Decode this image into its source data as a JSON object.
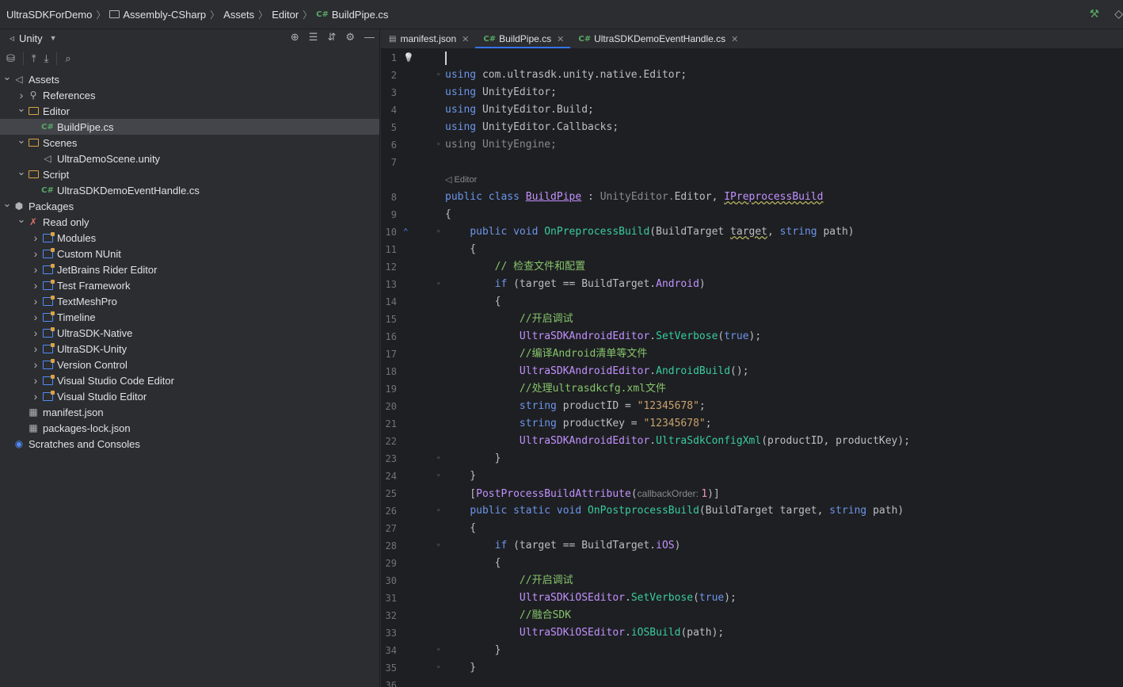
{
  "breadcrumb": {
    "items": [
      "UltraSDKForDemo",
      "Assembly-CSharp",
      "Assets",
      "Editor",
      "BuildPipe.cs"
    ],
    "cs_badge": "C#"
  },
  "panel": {
    "title": "Unity",
    "tree": [
      {
        "label": "Assets",
        "depth": 0,
        "expanded": true,
        "icon": "unity-asset-icon"
      },
      {
        "label": "References",
        "depth": 1,
        "expanded": false,
        "icon": "references-icon"
      },
      {
        "label": "Editor",
        "depth": 1,
        "expanded": true,
        "icon": "folder-icon"
      },
      {
        "label": "BuildPipe.cs",
        "depth": 2,
        "icon": "csharp-file-icon",
        "selected": true
      },
      {
        "label": "Scenes",
        "depth": 1,
        "expanded": true,
        "icon": "folder-icon"
      },
      {
        "label": "UltraDemoScene.unity",
        "depth": 2,
        "icon": "unity-scene-icon"
      },
      {
        "label": "Script",
        "depth": 1,
        "expanded": true,
        "icon": "folder-icon"
      },
      {
        "label": "UltraSDKDemoEventHandle.cs",
        "depth": 2,
        "icon": "csharp-file-icon"
      },
      {
        "label": "Packages",
        "depth": 0,
        "expanded": true,
        "icon": "packages-icon"
      },
      {
        "label": "Read only",
        "depth": 1,
        "expanded": true,
        "icon": "read-only-icon"
      },
      {
        "label": "Modules",
        "depth": 2,
        "expanded": false,
        "icon": "package-icon"
      },
      {
        "label": "Custom NUnit",
        "depth": 2,
        "expanded": false,
        "icon": "package-icon"
      },
      {
        "label": "JetBrains Rider Editor",
        "depth": 2,
        "expanded": false,
        "icon": "package-icon"
      },
      {
        "label": "Test Framework",
        "depth": 2,
        "expanded": false,
        "icon": "package-icon"
      },
      {
        "label": "TextMeshPro",
        "depth": 2,
        "expanded": false,
        "icon": "package-icon"
      },
      {
        "label": "Timeline",
        "depth": 2,
        "expanded": false,
        "icon": "package-icon"
      },
      {
        "label": "UltraSDK-Native",
        "depth": 2,
        "expanded": false,
        "icon": "package-icon"
      },
      {
        "label": "UltraSDK-Unity",
        "depth": 2,
        "expanded": false,
        "icon": "package-icon"
      },
      {
        "label": "Version Control",
        "depth": 2,
        "expanded": false,
        "icon": "package-icon"
      },
      {
        "label": "Visual Studio Code Editor",
        "depth": 2,
        "expanded": false,
        "icon": "package-icon"
      },
      {
        "label": "Visual Studio Editor",
        "depth": 2,
        "expanded": false,
        "icon": "package-icon"
      },
      {
        "label": "manifest.json",
        "depth": 1,
        "icon": "json-file-icon"
      },
      {
        "label": "packages-lock.json",
        "depth": 1,
        "icon": "json-file-icon"
      },
      {
        "label": "Scratches and Consoles",
        "depth": 0,
        "icon": "scratches-icon"
      }
    ]
  },
  "tabs": [
    {
      "label": "manifest.json",
      "icon": "json-file-icon",
      "badge": "",
      "active": false
    },
    {
      "label": "BuildPipe.cs",
      "icon": "csharp-file-icon",
      "badge": "C#",
      "active": true
    },
    {
      "label": "UltraSDKDemoEventHandle.cs",
      "icon": "csharp-file-icon",
      "badge": "C#",
      "active": false
    }
  ],
  "editor": {
    "codevision_hint": "Editor",
    "lines": [
      {
        "n": "1",
        "html": ""
      },
      {
        "n": "2",
        "tokens": [
          [
            "kw",
            "using "
          ],
          [
            "ns",
            "com.ultrasdk.unity.native.Editor"
          ],
          [
            "ns",
            ";"
          ]
        ]
      },
      {
        "n": "3",
        "tokens": [
          [
            "kw",
            "using "
          ],
          [
            "ns",
            "UnityEditor"
          ],
          [
            "ns",
            ";"
          ]
        ]
      },
      {
        "n": "4",
        "tokens": [
          [
            "kw",
            "using "
          ],
          [
            "ns",
            "UnityEditor.Build"
          ],
          [
            "ns",
            ";"
          ]
        ]
      },
      {
        "n": "5",
        "tokens": [
          [
            "kw",
            "using "
          ],
          [
            "ns",
            "UnityEditor.Callbacks"
          ],
          [
            "ns",
            ";"
          ]
        ]
      },
      {
        "n": "6",
        "tokens": [
          [
            "dim",
            "using UnityEngine;"
          ]
        ]
      },
      {
        "n": "7",
        "tokens": []
      },
      {
        "n": "8",
        "tokens": [
          [
            "kw",
            "public class "
          ],
          [
            "cls",
            "BuildPipe"
          ],
          [
            "ns",
            " : "
          ],
          [
            "dim",
            "UnityEditor."
          ],
          [
            "ns",
            "Editor, "
          ],
          [
            "ty uline",
            "IPreprocessBuild"
          ]
        ]
      },
      {
        "n": "9",
        "tokens": [
          [
            "ns",
            "{"
          ]
        ]
      },
      {
        "n": "10",
        "tokens": [
          [
            "ns",
            "    "
          ],
          [
            "kw",
            "public void "
          ],
          [
            "meth",
            "OnPreprocessBuild"
          ],
          [
            "ns",
            "("
          ],
          [
            "ns",
            "BuildTarget "
          ],
          [
            "ns uline",
            "target"
          ],
          [
            "ns",
            ", "
          ],
          [
            "kw",
            "string "
          ],
          [
            "ns",
            "path)"
          ]
        ]
      },
      {
        "n": "11",
        "tokens": [
          [
            "ns",
            "    {"
          ]
        ]
      },
      {
        "n": "12",
        "tokens": [
          [
            "cmt",
            "        // 检查文件和配置"
          ]
        ]
      },
      {
        "n": "13",
        "tokens": [
          [
            "ns",
            "        "
          ],
          [
            "kw",
            "if "
          ],
          [
            "ns",
            "(target == BuildTarget."
          ],
          [
            "ty",
            "Android"
          ],
          [
            "ns",
            ")"
          ]
        ]
      },
      {
        "n": "14",
        "tokens": [
          [
            "ns",
            "        {"
          ]
        ]
      },
      {
        "n": "15",
        "tokens": [
          [
            "cmt",
            "            //开启调试"
          ]
        ]
      },
      {
        "n": "16",
        "tokens": [
          [
            "ns",
            "            "
          ],
          [
            "ty",
            "UltraSDKAndroidEditor"
          ],
          [
            "ns",
            "."
          ],
          [
            "meth",
            "SetVerbose"
          ],
          [
            "ns",
            "("
          ],
          [
            "kw",
            "true"
          ],
          [
            "ns",
            ");"
          ]
        ]
      },
      {
        "n": "17",
        "tokens": [
          [
            "cmt",
            "            //编译Android清单等文件"
          ]
        ]
      },
      {
        "n": "18",
        "tokens": [
          [
            "ns",
            "            "
          ],
          [
            "ty",
            "UltraSDKAndroidEditor"
          ],
          [
            "ns",
            "."
          ],
          [
            "meth",
            "AndroidBuild"
          ],
          [
            "ns",
            "();"
          ]
        ]
      },
      {
        "n": "19",
        "tokens": [
          [
            "cmt",
            "            //处理ultrasdkcfg.xml文件"
          ]
        ]
      },
      {
        "n": "20",
        "tokens": [
          [
            "ns",
            "            "
          ],
          [
            "kw",
            "string "
          ],
          [
            "ns",
            "productID = "
          ],
          [
            "str",
            "\"12345678\""
          ],
          [
            "ns",
            ";"
          ]
        ]
      },
      {
        "n": "21",
        "tokens": [
          [
            "ns",
            "            "
          ],
          [
            "kw",
            "string "
          ],
          [
            "ns",
            "productKey = "
          ],
          [
            "str",
            "\"12345678\""
          ],
          [
            "ns",
            ";"
          ]
        ]
      },
      {
        "n": "22",
        "tokens": [
          [
            "ns",
            "            "
          ],
          [
            "ty",
            "UltraSDKAndroidEditor"
          ],
          [
            "ns",
            "."
          ],
          [
            "meth",
            "UltraSdkConfigXml"
          ],
          [
            "ns",
            "(productID, productKey);"
          ]
        ]
      },
      {
        "n": "23",
        "tokens": [
          [
            "ns",
            "        }"
          ]
        ]
      },
      {
        "n": "24",
        "tokens": [
          [
            "ns",
            "    }"
          ]
        ]
      },
      {
        "n": "25",
        "tokens": [
          [
            "ns",
            "    ["
          ],
          [
            "ty",
            "PostProcessBuildAttribute"
          ],
          [
            "ns",
            "("
          ],
          [
            "hint",
            "callbackOrder: "
          ],
          [
            "num",
            "1"
          ],
          [
            "ns",
            ")]"
          ]
        ]
      },
      {
        "n": "26",
        "tokens": [
          [
            "ns",
            "    "
          ],
          [
            "kw",
            "public static void "
          ],
          [
            "meth",
            "OnPostprocessBuild"
          ],
          [
            "ns",
            "(BuildTarget target, "
          ],
          [
            "kw",
            "string "
          ],
          [
            "ns",
            "path)"
          ]
        ]
      },
      {
        "n": "27",
        "tokens": [
          [
            "ns",
            "    {"
          ]
        ]
      },
      {
        "n": "28",
        "tokens": [
          [
            "ns",
            "        "
          ],
          [
            "kw",
            "if "
          ],
          [
            "ns",
            "(target == BuildTarget."
          ],
          [
            "ty",
            "iOS"
          ],
          [
            "ns",
            ")"
          ]
        ]
      },
      {
        "n": "29",
        "tokens": [
          [
            "ns",
            "        {"
          ]
        ]
      },
      {
        "n": "30",
        "tokens": [
          [
            "cmt",
            "            //开启调试"
          ]
        ]
      },
      {
        "n": "31",
        "tokens": [
          [
            "ns",
            "            "
          ],
          [
            "ty",
            "UltraSDKiOSEditor"
          ],
          [
            "ns",
            "."
          ],
          [
            "meth",
            "SetVerbose"
          ],
          [
            "ns",
            "("
          ],
          [
            "kw",
            "true"
          ],
          [
            "ns",
            ");"
          ]
        ]
      },
      {
        "n": "32",
        "tokens": [
          [
            "cmt",
            "            //融合SDK"
          ]
        ]
      },
      {
        "n": "33",
        "tokens": [
          [
            "ns",
            "            "
          ],
          [
            "ty",
            "UltraSDKiOSEditor"
          ],
          [
            "ns",
            "."
          ],
          [
            "meth",
            "iOSBuild"
          ],
          [
            "ns",
            "(path);"
          ]
        ]
      },
      {
        "n": "34",
        "tokens": [
          [
            "ns",
            "        }"
          ]
        ]
      },
      {
        "n": "35",
        "tokens": [
          [
            "ns",
            "    }"
          ]
        ]
      },
      {
        "n": "36",
        "tokens": []
      }
    ]
  },
  "colors": {
    "accent": "#3574f0",
    "keyword": "#6c95eb",
    "type": "#c191ff",
    "method": "#39cc9b",
    "string": "#c9a26d",
    "comment": "#85c46c",
    "background": "#1e1f22",
    "panel": "#2b2d30"
  }
}
